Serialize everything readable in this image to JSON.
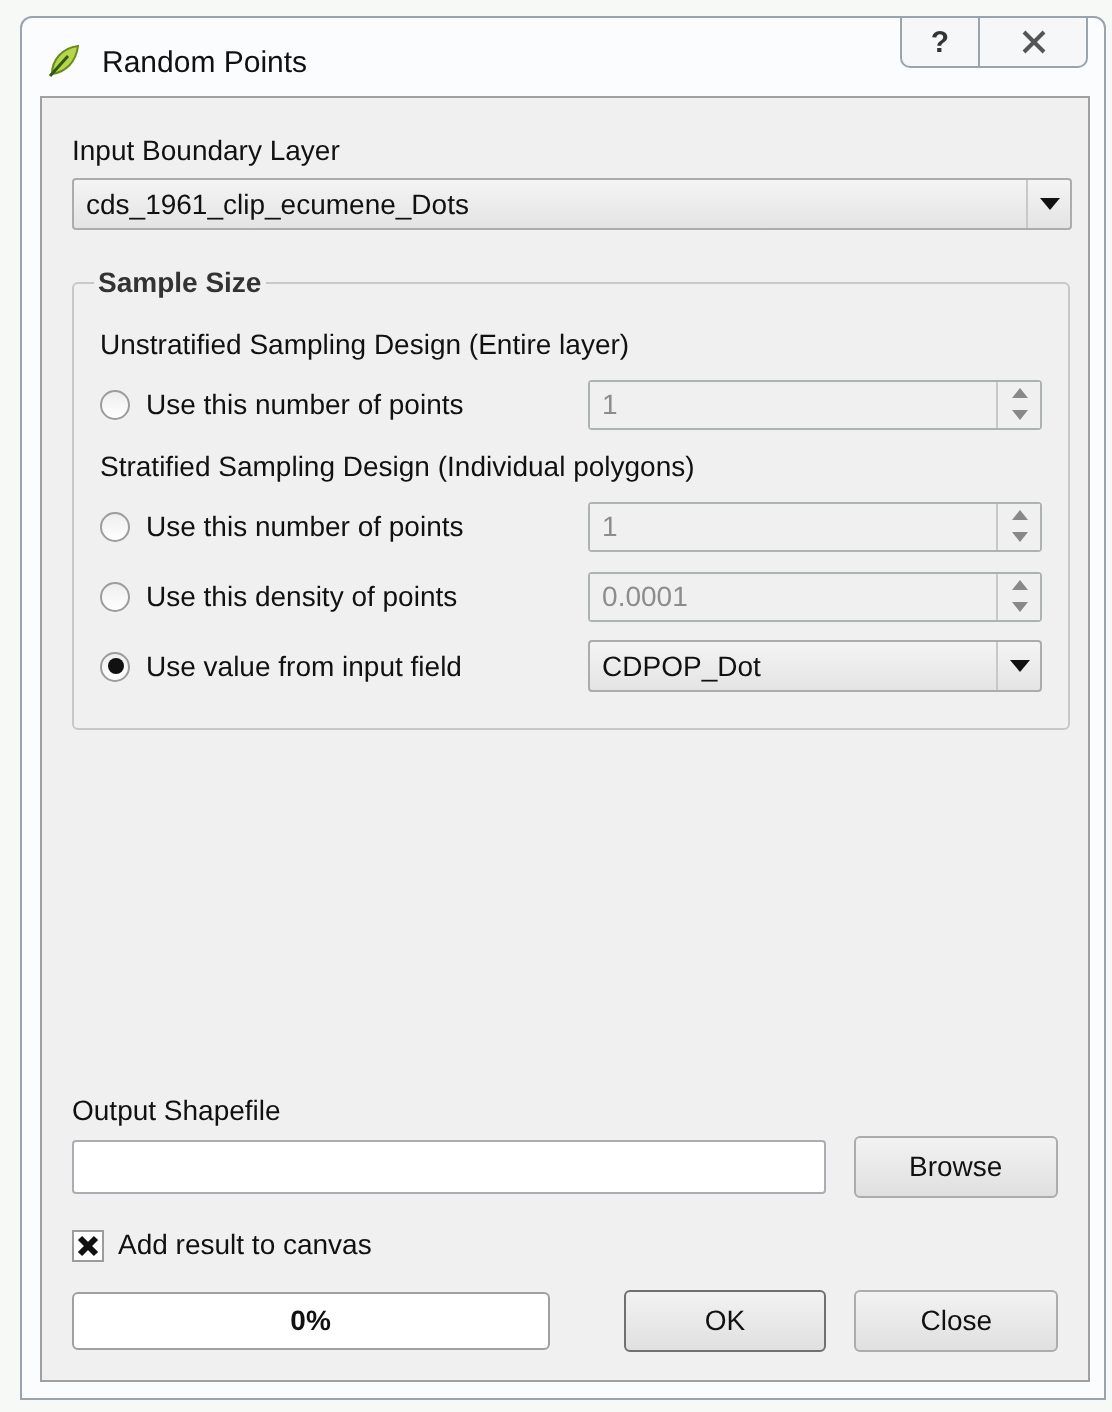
{
  "window": {
    "title": "Random Points",
    "help_button": "?"
  },
  "input_layer": {
    "label": "Input Boundary Layer",
    "value": "cds_1961_clip_ecumene_Dots"
  },
  "sample_size": {
    "title": "Sample Size",
    "sections": [
      {
        "label": "Unstratified Sampling Design (Entire layer)",
        "options": [
          {
            "label": "Use this number of points",
            "selected": false,
            "kind": "spin",
            "value": "1",
            "disabled": true
          }
        ]
      },
      {
        "label": "Stratified Sampling Design (Individual polygons)",
        "options": [
          {
            "label": "Use this number of points",
            "selected": false,
            "kind": "spin",
            "value": "1",
            "disabled": true
          },
          {
            "label": "Use this density of points",
            "selected": false,
            "kind": "spin",
            "value": "0.0001",
            "disabled": true
          },
          {
            "label": "Use value from input field",
            "selected": true,
            "kind": "combo",
            "value": "CDPOP_Dot",
            "disabled": false
          }
        ]
      }
    ]
  },
  "output": {
    "label": "Output Shapefile",
    "browse": "Browse"
  },
  "add_to_canvas": {
    "label": "Add result to canvas",
    "checked": true
  },
  "progress": {
    "level": 0,
    "text": "0%"
  },
  "buttons": [
    "OK",
    "Close"
  ]
}
